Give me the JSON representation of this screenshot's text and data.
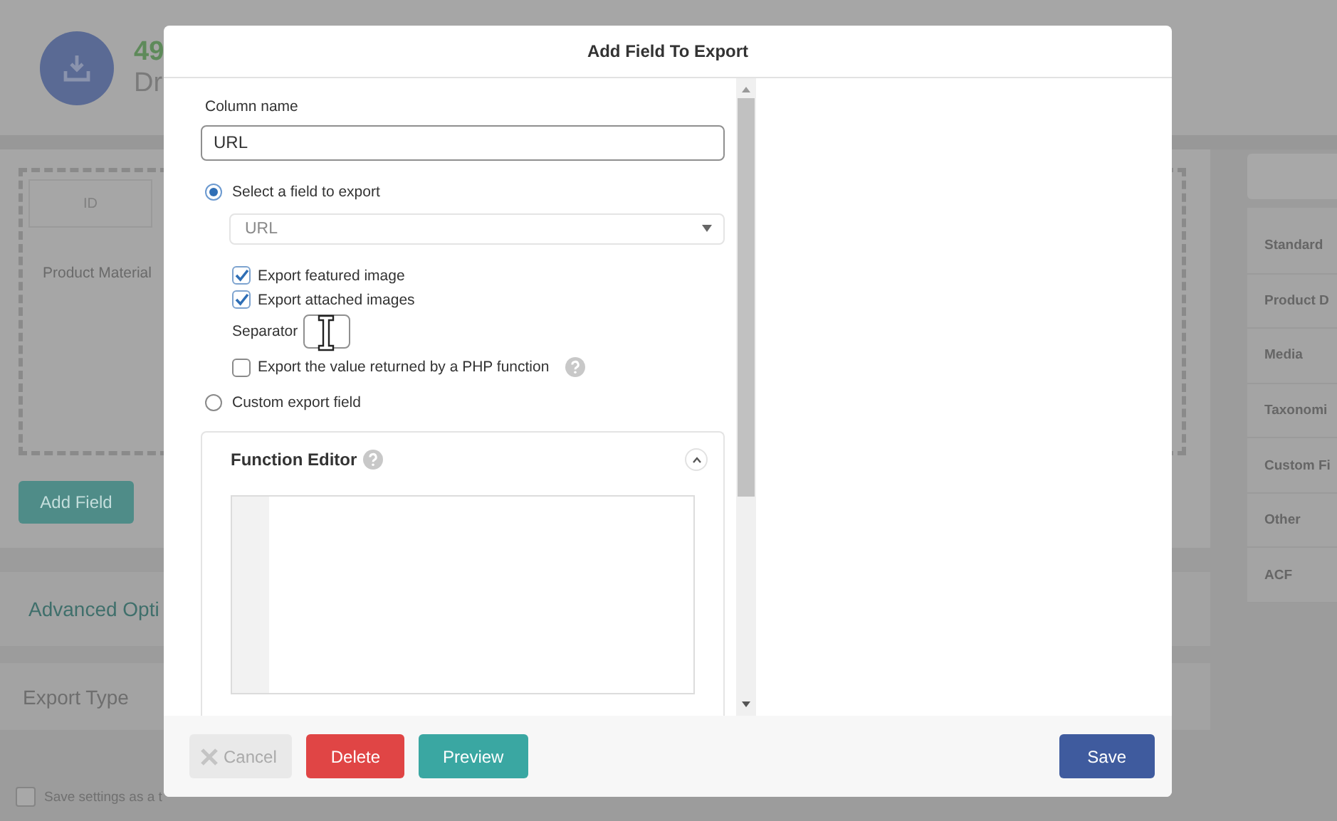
{
  "background": {
    "header": {
      "count": "49",
      "title": "Dr"
    },
    "column_tile": "ID",
    "field_row": "Product Material",
    "add_field_button": "Add Field",
    "sections": [
      "Advanced Opti",
      "Export Type"
    ],
    "save_settings": {
      "label": "Save settings as a t",
      "checked": false
    },
    "field_groups": [
      "Standard",
      "Product D",
      "Media",
      "Taxonomi",
      "Custom Fi",
      "Other",
      "ACF"
    ]
  },
  "modal": {
    "title": "Add Field To Export",
    "column_name": {
      "label": "Column name",
      "value": "URL"
    },
    "source_options": [
      {
        "label": "Select a field to export",
        "selected": true
      },
      {
        "label": "Custom export field",
        "selected": false
      }
    ],
    "field_select": {
      "value": "URL"
    },
    "export_options": [
      {
        "label": "Export featured image",
        "checked": true
      },
      {
        "label": "Export attached images",
        "checked": true
      }
    ],
    "separator": {
      "label": "Separator"
    },
    "php_function_option": {
      "label": "Export the value returned by a PHP function",
      "checked": false
    },
    "function_editor": {
      "title": "Function Editor",
      "expanded": true
    },
    "buttons": [
      {
        "label": "Cancel",
        "kind": "cancel",
        "disabled": true
      },
      {
        "label": "Delete",
        "kind": "delete",
        "disabled": false
      },
      {
        "label": "Preview",
        "kind": "preview",
        "disabled": false
      },
      {
        "label": "Save",
        "kind": "save",
        "disabled": false
      }
    ]
  }
}
